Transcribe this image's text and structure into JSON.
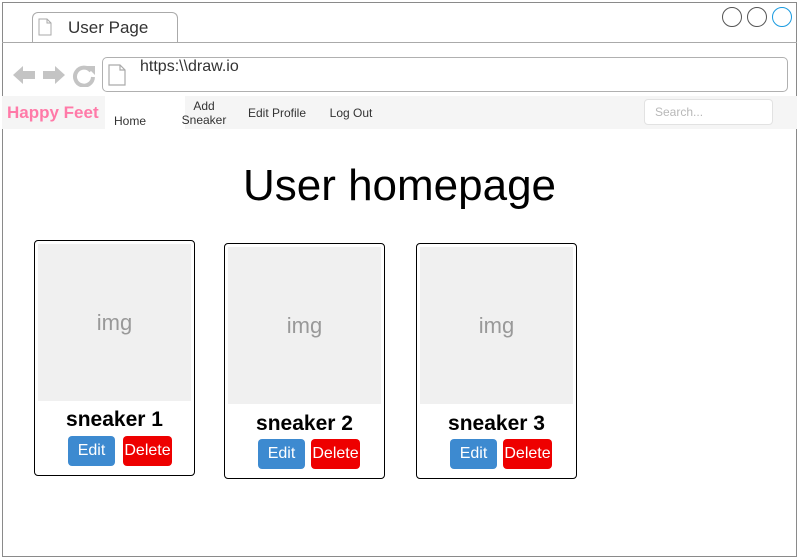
{
  "browser": {
    "tab_title": "User Page",
    "url": "https:\\\\draw.io"
  },
  "navbar": {
    "brand": "Happy Feet",
    "brand_color": "#ff7aa8",
    "items": [
      {
        "label": "Home"
      },
      {
        "label": "Add\nSneaker"
      },
      {
        "label": "Edit Profile"
      },
      {
        "label": "Log Out"
      }
    ],
    "search_placeholder": "Search..."
  },
  "main": {
    "title": "User homepage",
    "cards": [
      {
        "image_label": "img",
        "name": "sneaker 1",
        "edit_label": "Edit",
        "delete_label": "Delete"
      },
      {
        "image_label": "img",
        "name": "sneaker 2",
        "edit_label": "Edit",
        "delete_label": "Delete"
      },
      {
        "image_label": "img",
        "name": "sneaker 3",
        "edit_label": "Edit",
        "delete_label": "Delete"
      }
    ]
  },
  "colors": {
    "edit_button": "#3d8ad0",
    "delete_button": "#ee0000"
  }
}
